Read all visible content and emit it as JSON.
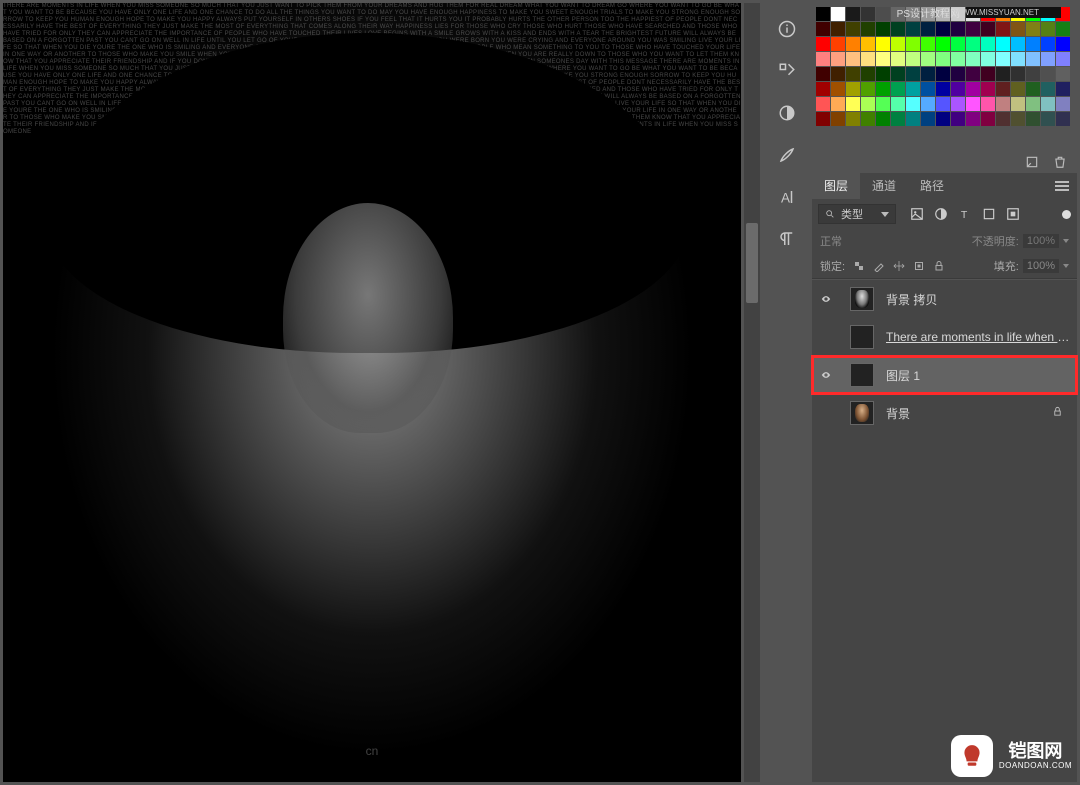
{
  "tutorial_banner": {
    "label": "PS设计教程网",
    "url_text": "WWW.MISSYUAN.NET"
  },
  "canvas": {
    "watermark": "cn"
  },
  "swatches": {
    "rows": [
      [
        "#000000",
        "#ffffff",
        "#1a1a1a",
        "#333333",
        "#4d4d4d",
        "#666666",
        "#808080",
        "#999999",
        "#b3b3b3",
        "#cccccc",
        "#e0e0e0",
        "#ff0000",
        "#ff7f00",
        "#ffff00",
        "#00ff00",
        "#00ffff",
        "#ff0000"
      ],
      [
        "#400000",
        "#402000",
        "#404000",
        "#204000",
        "#004000",
        "#004020",
        "#004040",
        "#002040",
        "#000040",
        "#200040",
        "#400040",
        "#400020",
        "#801515",
        "#805515",
        "#808015",
        "#558015",
        "#158015"
      ],
      [
        "#ff0000",
        "#ff4000",
        "#ff8000",
        "#ffbf00",
        "#ffff00",
        "#bfff00",
        "#80ff00",
        "#40ff00",
        "#00ff00",
        "#00ff40",
        "#00ff80",
        "#00ffbf",
        "#00ffff",
        "#00bfff",
        "#0080ff",
        "#0040ff",
        "#0000ff"
      ],
      [
        "#ff8080",
        "#ffa080",
        "#ffc080",
        "#ffe080",
        "#ffff80",
        "#e0ff80",
        "#c0ff80",
        "#a0ff80",
        "#80ff80",
        "#80ffa0",
        "#80ffc0",
        "#80ffe0",
        "#80ffff",
        "#80e0ff",
        "#80c0ff",
        "#80a0ff",
        "#8080ff"
      ],
      [
        "#400000",
        "#402000",
        "#404000",
        "#204000",
        "#004000",
        "#004020",
        "#004040",
        "#002040",
        "#000040",
        "#200040",
        "#400040",
        "#400020",
        "#202020",
        "#303030",
        "#404040",
        "#505050",
        "#606060"
      ],
      [
        "#a00000",
        "#a05000",
        "#a0a000",
        "#50a000",
        "#00a000",
        "#00a050",
        "#00a0a0",
        "#0050a0",
        "#0000a0",
        "#5000a0",
        "#a000a0",
        "#a00050",
        "#602020",
        "#606020",
        "#206020",
        "#206060",
        "#202060"
      ],
      [
        "#ff5555",
        "#ffaa55",
        "#ffff55",
        "#aaff55",
        "#55ff55",
        "#55ffaa",
        "#55ffff",
        "#55aaff",
        "#5555ff",
        "#aa55ff",
        "#ff55ff",
        "#ff55aa",
        "#c08080",
        "#c0c080",
        "#80c080",
        "#80c0c0",
        "#8080c0"
      ],
      [
        "#800000",
        "#804000",
        "#808000",
        "#408000",
        "#008000",
        "#008040",
        "#008080",
        "#004080",
        "#000080",
        "#400080",
        "#800080",
        "#800040",
        "#503030",
        "#505030",
        "#305030",
        "#305050",
        "#303050"
      ]
    ]
  },
  "panel": {
    "tabs": {
      "layers": "图层",
      "channels": "通道",
      "paths": "路径"
    },
    "active_tab": "layers",
    "filter_label": "类型",
    "blend_mode": "正常",
    "opacity_label": "不透明度:",
    "opacity_value": "100%",
    "lock_label": "锁定:",
    "fill_label": "填充:",
    "fill_value": "100%"
  },
  "layers": {
    "items": [
      {
        "name": "背景 拷贝",
        "visible": true,
        "kind": "pixel",
        "thumb": "portrait",
        "locked": false
      },
      {
        "name": "There are moments in life when yo...",
        "visible": false,
        "kind": "text",
        "thumb": "textfill",
        "locked": false
      },
      {
        "name": "图层 1",
        "visible": true,
        "kind": "pixel",
        "thumb": "black",
        "locked": false,
        "highlighted": true
      },
      {
        "name": "背景",
        "visible": false,
        "kind": "pixel",
        "thumb": "bg",
        "locked": true
      }
    ]
  },
  "brand": {
    "name": "铠图网",
    "domain": "DOANDOAN.COM"
  }
}
